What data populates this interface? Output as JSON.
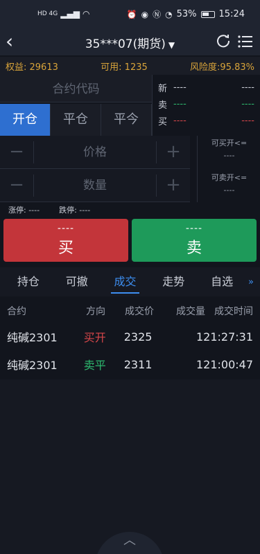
{
  "status_bar": {
    "network": "HD 4G",
    "battery": "53%",
    "time": "15:24"
  },
  "nav": {
    "title": "35***07(期货)",
    "caret": "▼"
  },
  "summary": {
    "equity": "权益: 29613",
    "available": "可用: 1235",
    "risk": "风险度:95.83%"
  },
  "order": {
    "contract_placeholder": "合约代码",
    "tabs": [
      "开仓",
      "平仓",
      "平今"
    ],
    "active_tab": 0,
    "price_placeholder": "价格",
    "qty_placeholder": "数量",
    "can_buy_label": "可买开<=",
    "can_buy_value": "----",
    "can_sell_label": "可卖开<=",
    "can_sell_value": "----",
    "limit_up": "涨停: ----",
    "limit_down": "跌停: ----",
    "buy_price": "----",
    "buy_label": "买",
    "sell_price": "----",
    "sell_label": "卖"
  },
  "quote": {
    "rows": [
      {
        "label": "新",
        "v1": "----",
        "v2": "----",
        "color": "#c9cdd6"
      },
      {
        "label": "卖",
        "v1": "----",
        "v2": "----",
        "color": "#2db86e"
      },
      {
        "label": "买",
        "v1": "----",
        "v2": "----",
        "color": "#d8474a"
      }
    ]
  },
  "record_tabs": {
    "items": [
      "持仓",
      "可撤",
      "成交",
      "走势",
      "自选"
    ],
    "active": 2,
    "more": "»"
  },
  "trades": {
    "headers": [
      "合约",
      "方向",
      "成交价",
      "成交量",
      "成交时间"
    ],
    "rows": [
      {
        "contract": "纯碱2301",
        "side": "买开",
        "side_color": "#d8474a",
        "price": "2325",
        "qty": "1",
        "time": "21:27:31"
      },
      {
        "contract": "纯碱2301",
        "side": "卖平",
        "side_color": "#2db86e",
        "price": "2311",
        "qty": "1",
        "time": "21:00:47"
      }
    ]
  },
  "pull_handle": "︿"
}
